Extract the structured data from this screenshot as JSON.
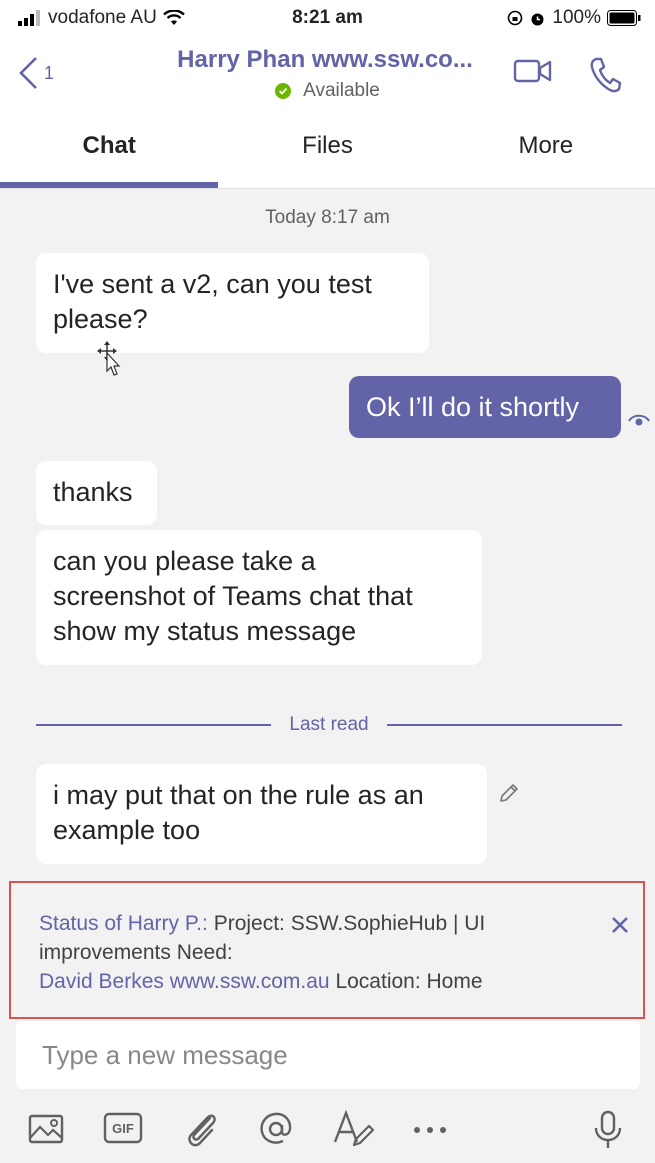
{
  "status_bar": {
    "carrier": "vodafone AU",
    "time": "8:21 am",
    "battery": "100%"
  },
  "header": {
    "back_count": "1",
    "contact_name": "Harry Phan www.ssw.co...",
    "presence": "Available",
    "presence_color": "#6bb700",
    "accent_color": "#6264a7"
  },
  "tabs": [
    {
      "label": "Chat",
      "active": true
    },
    {
      "label": "Files",
      "active": false
    },
    {
      "label": "More",
      "active": false
    }
  ],
  "chat": {
    "timestamp": "Today 8:17 am",
    "messages": [
      {
        "from": "them",
        "lines": [
          "I've sent a v2, can you test",
          "please?"
        ]
      },
      {
        "from": "me",
        "lines": [
          "Ok I’ll do it shortly"
        ]
      },
      {
        "from": "them",
        "lines": [
          "thanks"
        ]
      },
      {
        "from": "them",
        "lines": [
          "can you please take a",
          "screenshot of Teams chat that",
          "show my status message"
        ]
      },
      {
        "from": "them",
        "lines": [
          "i may put that on the rule as an",
          "example too"
        ]
      }
    ],
    "last_read_label": "Last read"
  },
  "status_message": {
    "prefix": "Status of Harry P.:",
    "text_1": " Project: SSW.SophieHub | UI",
    "text_2": "improvements Need:",
    "mention": "David Berkes www.ssw.com.au",
    "text_3": " Location: Home"
  },
  "composer": {
    "placeholder": "Type a new message"
  },
  "toolbar_icons": [
    "image-icon",
    "gif-icon",
    "attach-icon",
    "mention-icon",
    "format-icon",
    "more-icon",
    "microphone-icon"
  ]
}
